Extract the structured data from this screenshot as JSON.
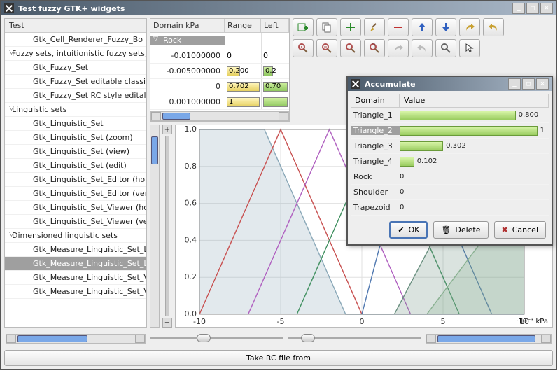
{
  "window": {
    "title": "Test fuzzy GTK+ widgets"
  },
  "sidebar": {
    "header": "Test",
    "rows": [
      {
        "label": "Gtk_Cell_Renderer_Fuzzy_Bo",
        "indent": true
      },
      {
        "label": "Fuzzy sets, intuitionistic fuzzy sets,",
        "group": true
      },
      {
        "label": "Gtk_Fuzzy_Set",
        "indent": true
      },
      {
        "label": "Gtk_Fuzzy_Set editable classif",
        "indent": true
      },
      {
        "label": "Gtk_Fuzzy_Set RC style edital",
        "indent": true
      },
      {
        "label": "Linguistic sets",
        "group": true
      },
      {
        "label": "Gtk_Linguistic_Set",
        "indent": true
      },
      {
        "label": "Gtk_Linguistic_Set (zoom)",
        "indent": true
      },
      {
        "label": "Gtk_Linguistic_Set (view)",
        "indent": true
      },
      {
        "label": "Gtk_Linguistic_Set (edit)",
        "indent": true
      },
      {
        "label": "Gtk_Linguistic_Set_Editor (hor",
        "indent": true
      },
      {
        "label": "Gtk_Linguistic_Set_Editor (ver",
        "indent": true
      },
      {
        "label": "Gtk_Linguistic_Set_Viewer (ho",
        "indent": true
      },
      {
        "label": "Gtk_Linguistic_Set_Viewer (ve",
        "indent": true
      },
      {
        "label": "Dimensioned linguistic sets",
        "group": true
      },
      {
        "label": "Gtk_Measure_Linguistic_Set_L",
        "indent": true
      },
      {
        "label": "Gtk_Measure_Linguistic_Set_L",
        "indent": true,
        "selected": true
      },
      {
        "label": "Gtk_Measure_Linguistic_Set_V",
        "indent": true
      },
      {
        "label": "Gtk_Measure_Linguistic_Set_V",
        "indent": true
      }
    ]
  },
  "data_table": {
    "columns": [
      "Domain kPa",
      "Range",
      "Left"
    ],
    "group": "Rock",
    "rows": [
      {
        "domain": "-0.01000000",
        "range": "0",
        "left": "0"
      },
      {
        "domain": "-0.005000000",
        "range": "0.200",
        "range_bar": 40,
        "left": "0.2",
        "left_bar": 40
      },
      {
        "domain": "0",
        "range": "0.702",
        "range_bar": 100,
        "left": "0.70",
        "left_bar": 100
      },
      {
        "domain": "0.001000000",
        "range": "1",
        "range_bar": 100,
        "range_yellow": true,
        "left": "",
        "left_bar": 100
      }
    ]
  },
  "toolbar_icons": [
    [
      "add-child",
      "copy",
      "plus",
      "brush",
      "minus",
      "arrow-up",
      "arrow-down",
      "redo",
      "undo"
    ],
    [
      "zoom-in",
      "zoom-out",
      "zoom-fit",
      "zoom-reset",
      "redo2",
      "undo2",
      "find",
      "pointer"
    ]
  ],
  "chart_data": {
    "type": "line",
    "xlabel": "",
    "ylabel": "",
    "x_unit": "·10⁻³ kPa",
    "xlim": [
      -10,
      10
    ],
    "ylim": [
      0,
      1.0
    ],
    "xticks": [
      -10,
      -5,
      0,
      5,
      10
    ],
    "yticks": [
      0.0,
      0.2,
      0.4,
      0.6,
      0.8,
      1.0
    ],
    "series": [
      {
        "name": "Rock",
        "color": "#8aa8b8",
        "fill": true,
        "points": [
          [
            -10,
            1.0
          ],
          [
            -6,
            1.0
          ],
          [
            -1,
            0.0
          ],
          [
            10,
            0.0
          ]
        ]
      },
      {
        "name": "Triangle_1",
        "color": "#c85050",
        "fill": false,
        "points": [
          [
            -10,
            0.0
          ],
          [
            -5,
            1.0
          ],
          [
            0,
            0.0
          ]
        ]
      },
      {
        "name": "Triangle_2",
        "color": "#b060c0",
        "fill": false,
        "points": [
          [
            -7,
            0.0
          ],
          [
            -2,
            1.0
          ],
          [
            3,
            0.0
          ]
        ]
      },
      {
        "name": "Triangle_3",
        "color": "#409060",
        "fill": false,
        "points": [
          [
            -4,
            0.0
          ],
          [
            1,
            1.0
          ],
          [
            6,
            0.0
          ]
        ]
      },
      {
        "name": "Triangle_4",
        "color": "#5078b0",
        "fill": false,
        "points": [
          [
            0,
            0.0
          ],
          [
            3,
            1.0
          ],
          [
            8,
            0.0
          ]
        ]
      },
      {
        "name": "Shoulder",
        "color": "#6a9080",
        "fill": true,
        "points": [
          [
            2,
            0.0
          ],
          [
            8,
            1.0
          ],
          [
            10,
            1.0
          ]
        ]
      },
      {
        "name": "Trapezoid",
        "color": "#88b090",
        "fill": true,
        "points": [
          [
            4,
            0.0
          ],
          [
            10,
            0.7
          ]
        ]
      }
    ]
  },
  "dialog": {
    "title": "Accumulate",
    "columns": [
      "Domain",
      "Value"
    ],
    "rows": [
      {
        "name": "Triangle_1",
        "value": "0.800",
        "bar": 80
      },
      {
        "name": "Triangle_2",
        "value": "1",
        "bar": 100,
        "selected": true
      },
      {
        "name": "Triangle_3",
        "value": "0.302",
        "bar": 30
      },
      {
        "name": "Triangle_4",
        "value": "0.102",
        "bar": 10
      },
      {
        "name": "Rock",
        "value": "0",
        "bar": 0
      },
      {
        "name": "Shoulder",
        "value": "0",
        "bar": 0
      },
      {
        "name": "Trapezoid",
        "value": "0",
        "bar": 0
      }
    ],
    "buttons": {
      "ok": "OK",
      "delete": "Delete",
      "cancel": "Cancel"
    }
  },
  "footer": {
    "take": "Take RC file from"
  }
}
